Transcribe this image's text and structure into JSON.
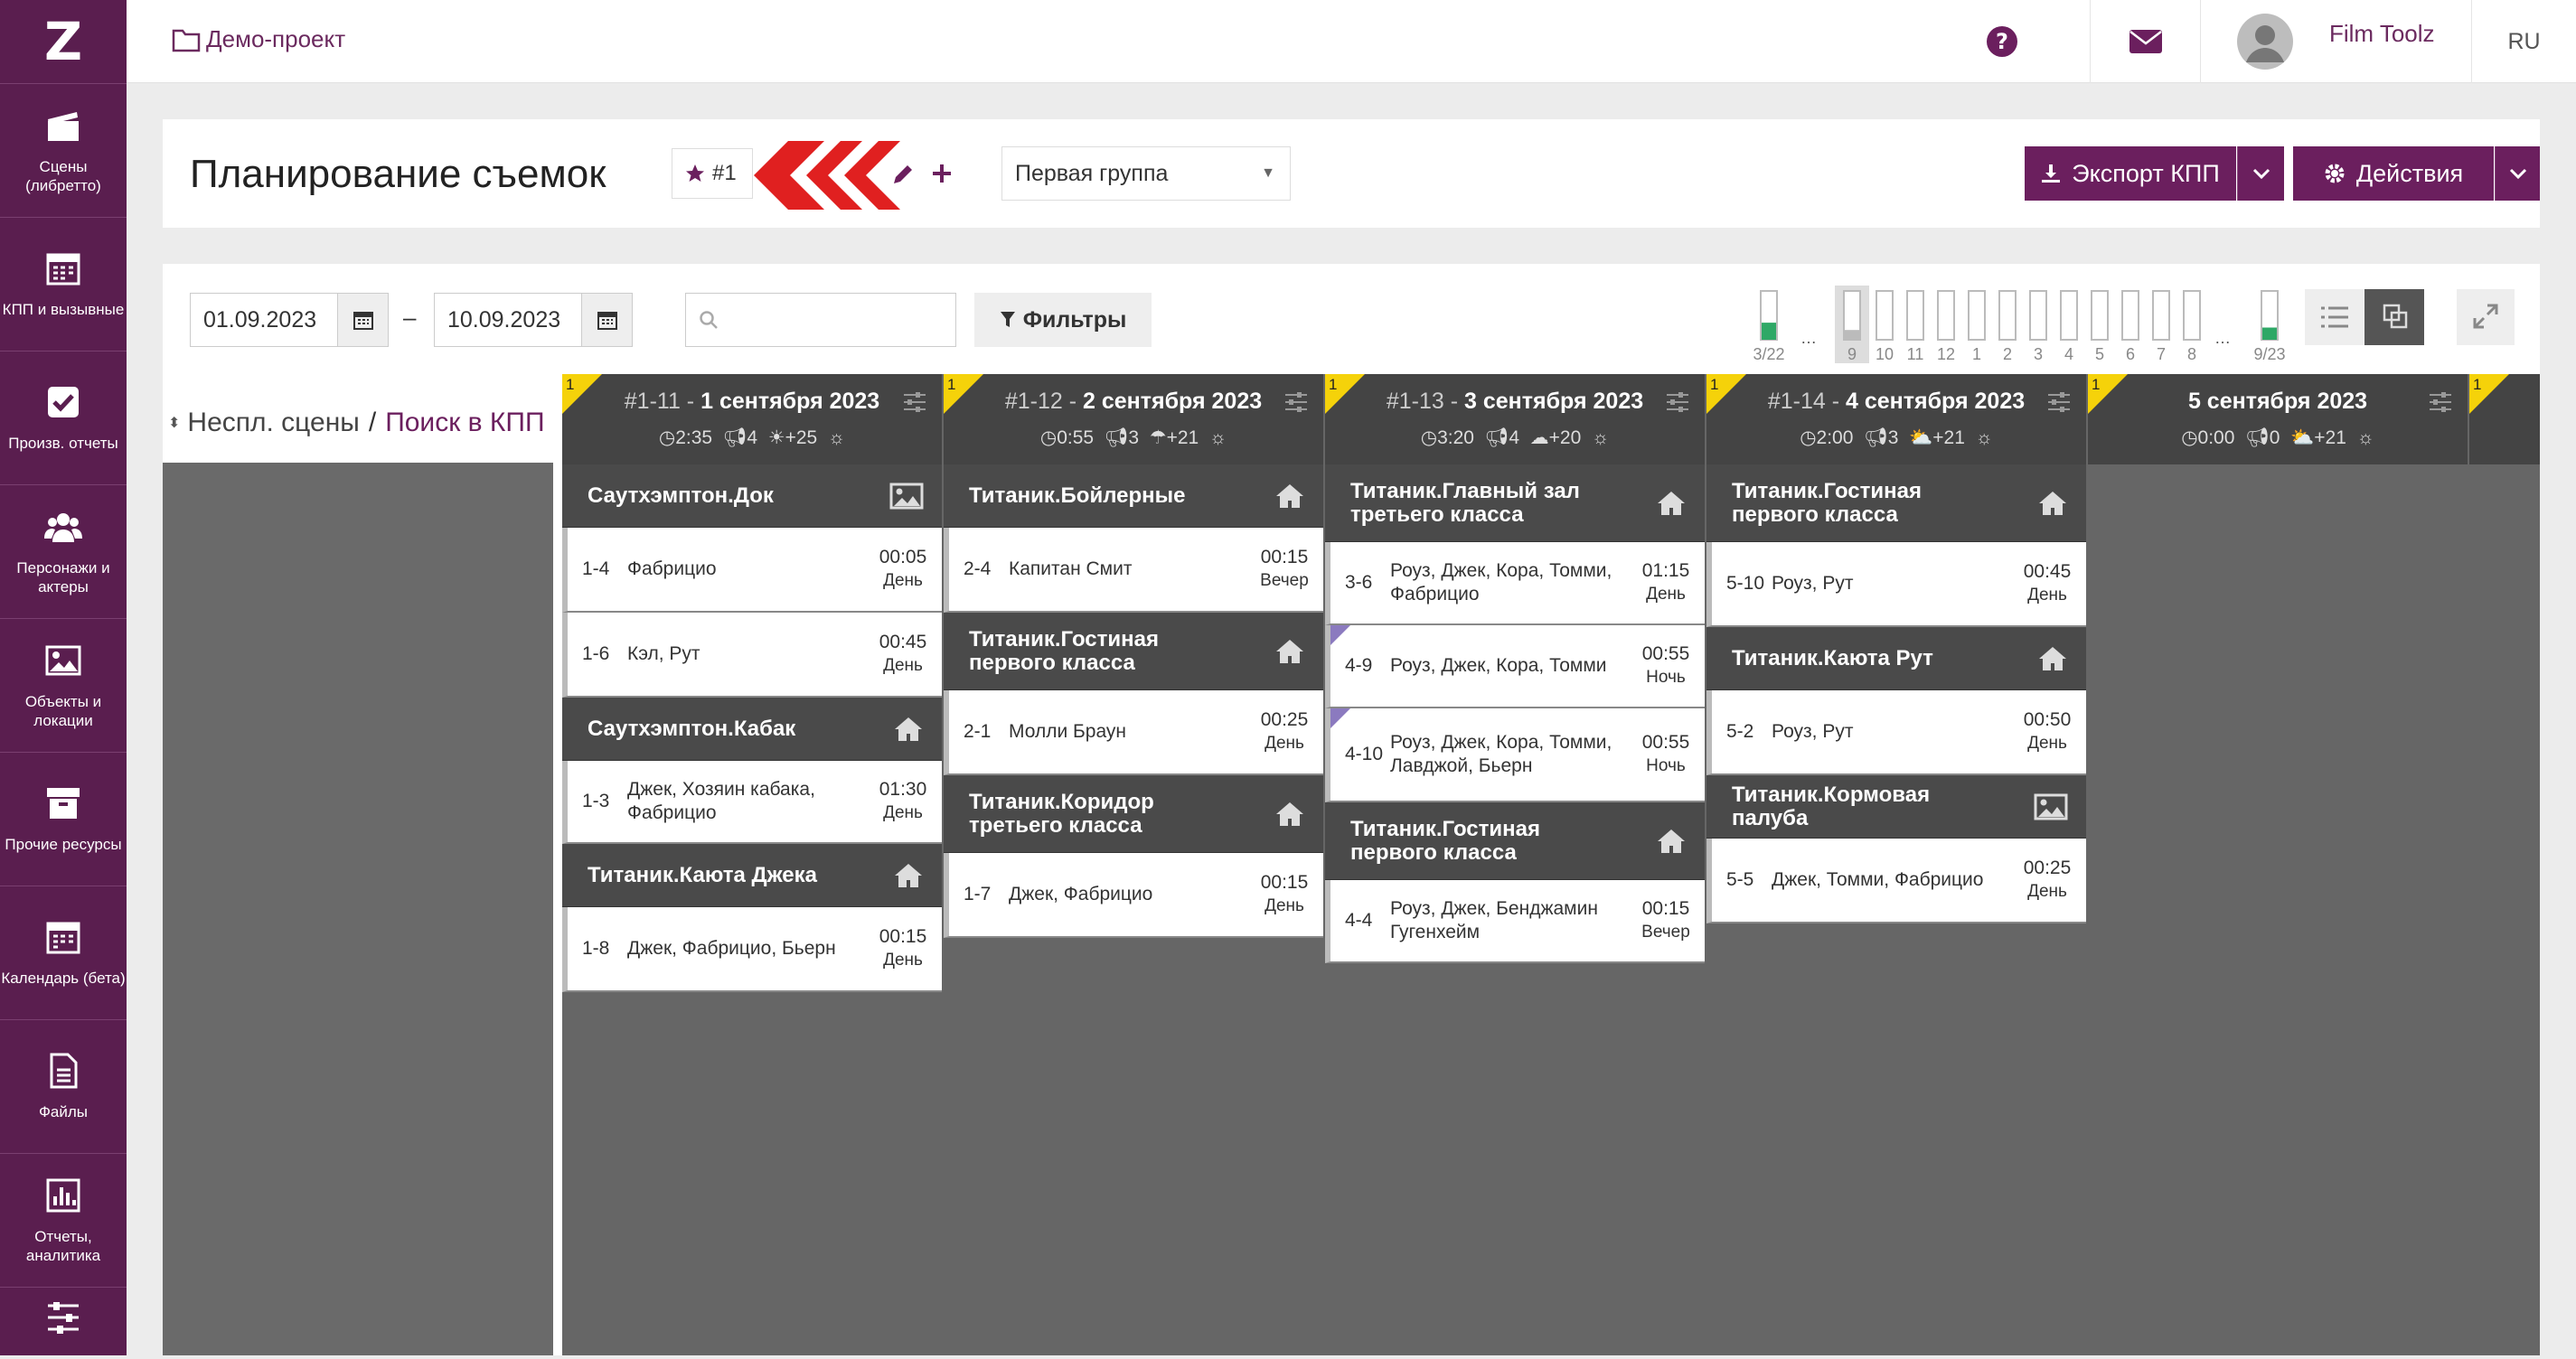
{
  "topbar": {
    "project": "Демо-проект",
    "user": "Film Toolz",
    "lang": "RU"
  },
  "sidebar": {
    "logo": "Z",
    "items": [
      {
        "label": "Сцены (либретто)",
        "icon": "clapperboard-icon"
      },
      {
        "label": "КПП и вызывные",
        "icon": "calendar-grid-icon"
      },
      {
        "label": "Произв. отчеты",
        "icon": "checkbox-icon"
      },
      {
        "label": "Персонажи и актеры",
        "icon": "users-icon"
      },
      {
        "label": "Объекты и локации",
        "icon": "image-icon"
      },
      {
        "label": "Прочие ресурсы",
        "icon": "archive-icon"
      },
      {
        "label": "Календарь (бета)",
        "icon": "calendar-icon"
      },
      {
        "label": "Файлы",
        "icon": "file-icon"
      },
      {
        "label": "Отчеты, аналитика",
        "icon": "bar-chart-icon"
      },
      {
        "label": "",
        "icon": "sliders-icon"
      }
    ]
  },
  "header": {
    "title": "Планирование съемок",
    "variant": "#1",
    "group": "Первая группа",
    "export": "Экспорт КПП",
    "actions": "Действия"
  },
  "toolbar": {
    "date_from": "01.09.2023",
    "date_to": "10.09.2023",
    "dash": "–",
    "search_placeholder": "",
    "filters": "Фильтры"
  },
  "day_bars": {
    "labels": [
      "3/22",
      "…",
      "9",
      "10",
      "11",
      "12",
      "1",
      "2",
      "3",
      "4",
      "5",
      "6",
      "7",
      "8",
      "…",
      "9/23"
    ],
    "fills": [
      0.35,
      0,
      0.2,
      0,
      0,
      0,
      0,
      0,
      0,
      0,
      0,
      0,
      0,
      0,
      0,
      0.25
    ]
  },
  "left": {
    "unused": "Неспл. сцены",
    "sep": "/",
    "search": "Поиск в КПП"
  },
  "days": [
    {
      "num": "1",
      "prefix": "#1-11 - ",
      "date": "1 сентября 2023",
      "dur": "2:35",
      "cast": "4",
      "weather": "☀",
      "temp": "+25",
      "blocks": [
        {
          "loc": "Саутхэмптон.Док",
          "type": "image-icon",
          "scenes": [
            {
              "id": "1-4",
              "chars": "Фабрицио",
              "time": "00:05",
              "tod": "День"
            },
            {
              "id": "1-6",
              "chars": "Кэл, Рут",
              "time": "00:45",
              "tod": "День"
            }
          ]
        },
        {
          "loc": "Саутхэмптон.Кабак",
          "type": "home-icon",
          "scenes": [
            {
              "id": "1-3",
              "chars": "Джек, Хозяин кабака, Фабрицио",
              "time": "01:30",
              "tod": "День"
            }
          ]
        },
        {
          "loc": "Титаник.Каюта Джека",
          "type": "home-icon",
          "scenes": [
            {
              "id": "1-8",
              "chars": "Джек, Фабрицио, Бьерн",
              "time": "00:15",
              "tod": "День"
            }
          ]
        }
      ]
    },
    {
      "num": "1",
      "prefix": "#1-12 - ",
      "date": "2 сентября 2023",
      "dur": "0:55",
      "cast": "3",
      "weather": "☂",
      "temp": "+21",
      "blocks": [
        {
          "loc": "Титаник.Бойлерные",
          "type": "home-icon",
          "scenes": [
            {
              "id": "2-4",
              "chars": "Капитан Смит",
              "time": "00:15",
              "tod": "Вечер"
            }
          ]
        },
        {
          "loc": "Титаник.Гостиная первого класса",
          "type": "home-icon",
          "scenes": [
            {
              "id": "2-1",
              "chars": "Молли Браун",
              "time": "00:25",
              "tod": "День"
            }
          ]
        },
        {
          "loc": "Титаник.Коридор третьего класса",
          "type": "home-icon",
          "scenes": [
            {
              "id": "1-7",
              "chars": "Джек, Фабрицио",
              "time": "00:15",
              "tod": "День"
            }
          ]
        }
      ]
    },
    {
      "num": "1",
      "prefix": "#1-13 - ",
      "date": "3 сентября 2023",
      "dur": "3:20",
      "cast": "4",
      "weather": "☁",
      "temp": "+20",
      "blocks": [
        {
          "loc": "Титаник.Главный зал третьего класса",
          "type": "home-icon",
          "scenes": [
            {
              "id": "3-6",
              "chars": "Роуз, Джек, Кора, Томми, Фабрицио",
              "time": "01:15",
              "tod": "День"
            },
            {
              "id": "4-9",
              "chars": "Роуз, Джек, Кора, Томми",
              "time": "00:55",
              "tod": "Ночь",
              "night": true
            },
            {
              "id": "4-10",
              "chars": "Роуз, Джек, Кора, Томми, Лавджой, Бьерн",
              "time": "00:55",
              "tod": "Ночь",
              "night": true
            }
          ]
        },
        {
          "loc": "Титаник.Гостиная первого класса",
          "type": "home-icon",
          "scenes": [
            {
              "id": "4-4",
              "chars": "Роуз, Джек, Бенджамин Гугенхейм",
              "time": "00:15",
              "tod": "Вечер"
            }
          ]
        }
      ]
    },
    {
      "num": "1",
      "prefix": "#1-14 - ",
      "date": "4 сентября 2023",
      "dur": "2:00",
      "cast": "3",
      "weather": "⛅",
      "temp": "+21",
      "blocks": [
        {
          "loc": "Титаник.Гостиная первого класса",
          "type": "home-icon",
          "scenes": [
            {
              "id": "5-10",
              "chars": "Роуз, Рут",
              "time": "00:45",
              "tod": "День"
            }
          ]
        },
        {
          "loc": "Титаник.Каюта Рут",
          "type": "home-icon",
          "scenes": [
            {
              "id": "5-2",
              "chars": "Роуз, Рут",
              "time": "00:50",
              "tod": "День"
            }
          ]
        },
        {
          "loc": "Титаник.Кормовая палуба",
          "type": "image-icon",
          "scenes": [
            {
              "id": "5-5",
              "chars": "Джек, Томми, Фабрицио",
              "time": "00:25",
              "tod": "День"
            }
          ]
        }
      ]
    },
    {
      "num": "1",
      "prefix": "",
      "date": "5 сентября 2023",
      "dur": "0:00",
      "cast": "0",
      "weather": "⛅",
      "temp": "+21",
      "blocks": []
    }
  ],
  "colors": {
    "brand": "#5a1e4f",
    "button": "#6b1f5e",
    "accent_red": "#e02020",
    "bar_green": "#2ea866"
  }
}
